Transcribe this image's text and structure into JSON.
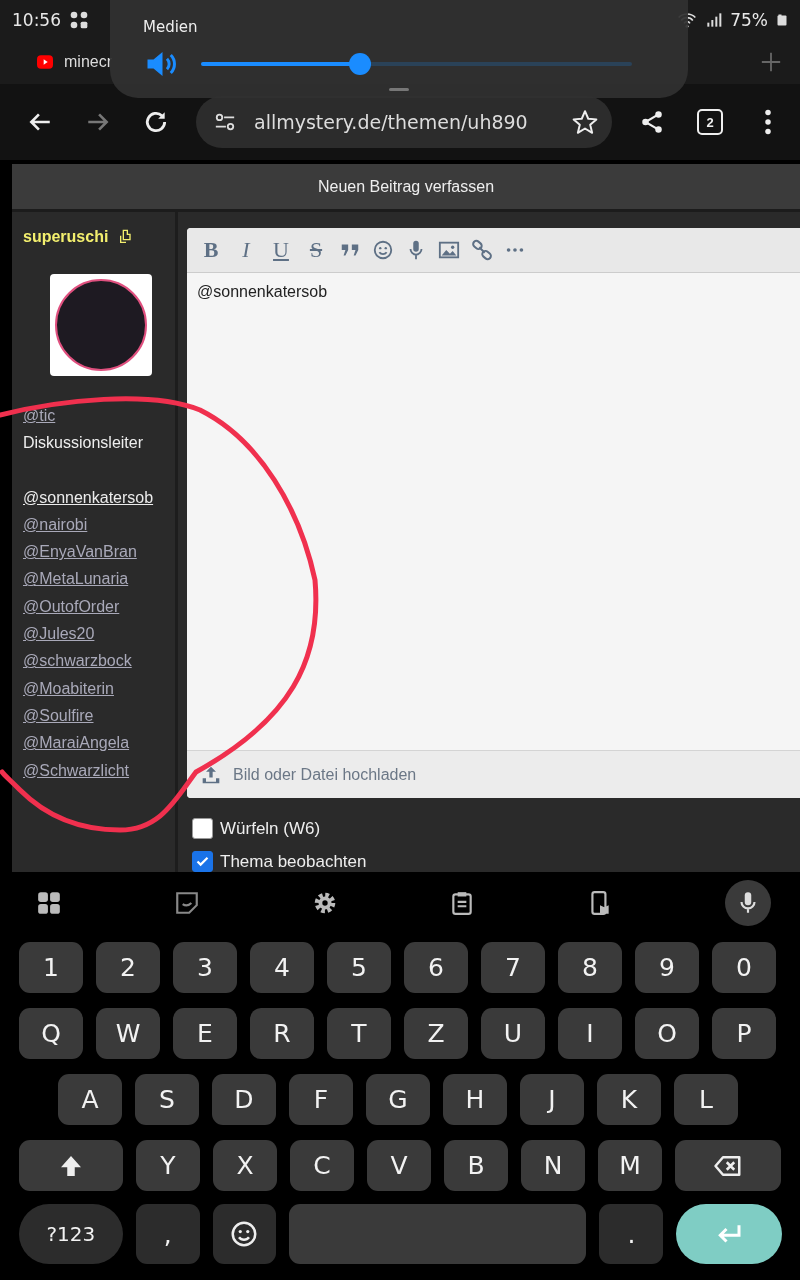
{
  "status_bar": {
    "time": "10:56",
    "battery": "75%"
  },
  "tabs": [
    {
      "title": "minecr"
    }
  ],
  "media_panel": {
    "title": "Medien",
    "volume": {
      "level": 0.37
    }
  },
  "toolbar": {
    "url": "allmystery.de/themen/uh890",
    "tab_count": "2"
  },
  "composer": {
    "title": "Neuen Beitrag verfassen",
    "sidebar": {
      "username": "superuschi",
      "lines": [
        {
          "kind": "link",
          "text": "@tic",
          "active": false
        },
        {
          "kind": "text",
          "text": "Diskussionsleiter"
        },
        {
          "kind": "gap"
        },
        {
          "kind": "link",
          "text": "@sonnenkatersob",
          "active": true
        },
        {
          "kind": "link",
          "text": "@nairobi",
          "active": false
        },
        {
          "kind": "link",
          "text": "@EnyaVanBran",
          "active": false
        },
        {
          "kind": "link",
          "text": "@MetaLunaria",
          "active": false
        },
        {
          "kind": "link",
          "text": "@OutofOrder",
          "active": false
        },
        {
          "kind": "link",
          "text": "@Jules20",
          "active": false
        },
        {
          "kind": "link",
          "text": "@schwarzbock",
          "active": false
        },
        {
          "kind": "link",
          "text": "@Moabiterin",
          "active": false
        },
        {
          "kind": "link",
          "text": "@Soulfire",
          "active": false
        },
        {
          "kind": "link",
          "text": "@MaraiAngela",
          "active": false
        },
        {
          "kind": "link",
          "text": "@Schwarzlicht",
          "active": false
        }
      ]
    },
    "editor_tools": [
      {
        "kind": "bold",
        "label": "B"
      },
      {
        "kind": "italic",
        "label": "I"
      },
      {
        "kind": "underline",
        "label": "U"
      },
      {
        "kind": "strike",
        "label": "S"
      },
      {
        "kind": "quote"
      },
      {
        "kind": "emoji"
      },
      {
        "kind": "mic"
      },
      {
        "kind": "image"
      },
      {
        "kind": "link"
      },
      {
        "kind": "more"
      }
    ],
    "text": "@sonnenkatersob",
    "upload": "Bild oder Datei hochladen",
    "options": [
      {
        "label": "Würfeln (W6)",
        "checked": false
      },
      {
        "label": "Thema beobachten",
        "checked": true
      }
    ]
  },
  "keyboard": {
    "tools": [
      {
        "kind": "grid"
      },
      {
        "kind": "sticker"
      },
      {
        "kind": "gear"
      },
      {
        "kind": "clipboard"
      },
      {
        "kind": "phone"
      },
      {
        "kind": "mic"
      }
    ],
    "rows": [
      [
        {
          "kind": "char",
          "label": "1"
        },
        {
          "kind": "char",
          "label": "2"
        },
        {
          "kind": "char",
          "label": "3"
        },
        {
          "kind": "char",
          "label": "4"
        },
        {
          "kind": "char",
          "label": "5"
        },
        {
          "kind": "char",
          "label": "6"
        },
        {
          "kind": "char",
          "label": "7"
        },
        {
          "kind": "char",
          "label": "8"
        },
        {
          "kind": "char",
          "label": "9"
        },
        {
          "kind": "char",
          "label": "0"
        }
      ],
      [
        {
          "kind": "char",
          "label": "Q"
        },
        {
          "kind": "char",
          "label": "W"
        },
        {
          "kind": "char",
          "label": "E"
        },
        {
          "kind": "char",
          "label": "R"
        },
        {
          "kind": "char",
          "label": "T"
        },
        {
          "kind": "char",
          "label": "Z"
        },
        {
          "kind": "char",
          "label": "U"
        },
        {
          "kind": "char",
          "label": "I"
        },
        {
          "kind": "char",
          "label": "O"
        },
        {
          "kind": "char",
          "label": "P"
        }
      ],
      [
        {
          "kind": "char",
          "label": "A"
        },
        {
          "kind": "char",
          "label": "S"
        },
        {
          "kind": "char",
          "label": "D"
        },
        {
          "kind": "char",
          "label": "F"
        },
        {
          "kind": "char",
          "label": "G"
        },
        {
          "kind": "char",
          "label": "H"
        },
        {
          "kind": "char",
          "label": "J"
        },
        {
          "kind": "char",
          "label": "K"
        },
        {
          "kind": "char",
          "label": "L"
        }
      ],
      [
        {
          "kind": "shift"
        },
        {
          "kind": "char",
          "label": "Y"
        },
        {
          "kind": "char",
          "label": "X"
        },
        {
          "kind": "char",
          "label": "C"
        },
        {
          "kind": "char",
          "label": "V"
        },
        {
          "kind": "char",
          "label": "B"
        },
        {
          "kind": "char",
          "label": "N"
        },
        {
          "kind": "char",
          "label": "M"
        },
        {
          "kind": "backspace"
        }
      ],
      [
        {
          "kind": "mode",
          "label": "?123"
        },
        {
          "kind": "char",
          "label": ","
        },
        {
          "kind": "emoji"
        },
        {
          "kind": "space"
        },
        {
          "kind": "char",
          "label": "."
        },
        {
          "kind": "enter"
        }
      ]
    ]
  }
}
